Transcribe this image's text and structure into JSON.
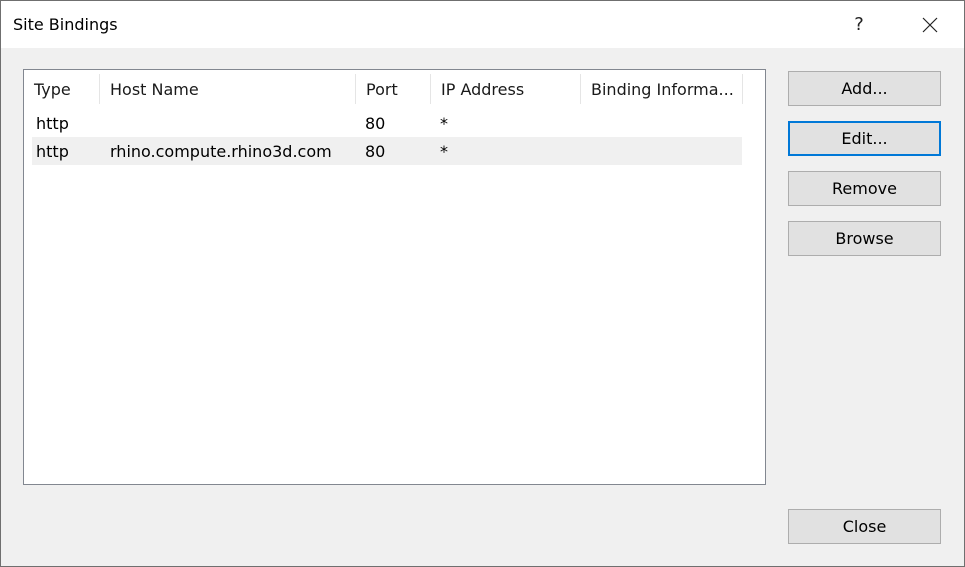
{
  "window": {
    "title": "Site Bindings",
    "help_glyph": "?",
    "close_glyph": "✕"
  },
  "bindings": {
    "columns": [
      {
        "label": "Type"
      },
      {
        "label": "Host Name"
      },
      {
        "label": "Port"
      },
      {
        "label": "IP Address"
      },
      {
        "label": "Binding Informa..."
      }
    ],
    "rows": [
      {
        "type": "http",
        "host": "",
        "port": "80",
        "ip": "*",
        "info": "",
        "selected": false
      },
      {
        "type": "http",
        "host": "rhino.compute.rhino3d.com",
        "port": "80",
        "ip": "*",
        "info": "",
        "selected": true
      }
    ]
  },
  "buttons": {
    "add": "Add...",
    "edit": "Edit...",
    "remove": "Remove",
    "browse": "Browse",
    "close": "Close"
  },
  "colors": {
    "focus_border": "#0078d7",
    "selected_row": "#f0f0f0"
  }
}
